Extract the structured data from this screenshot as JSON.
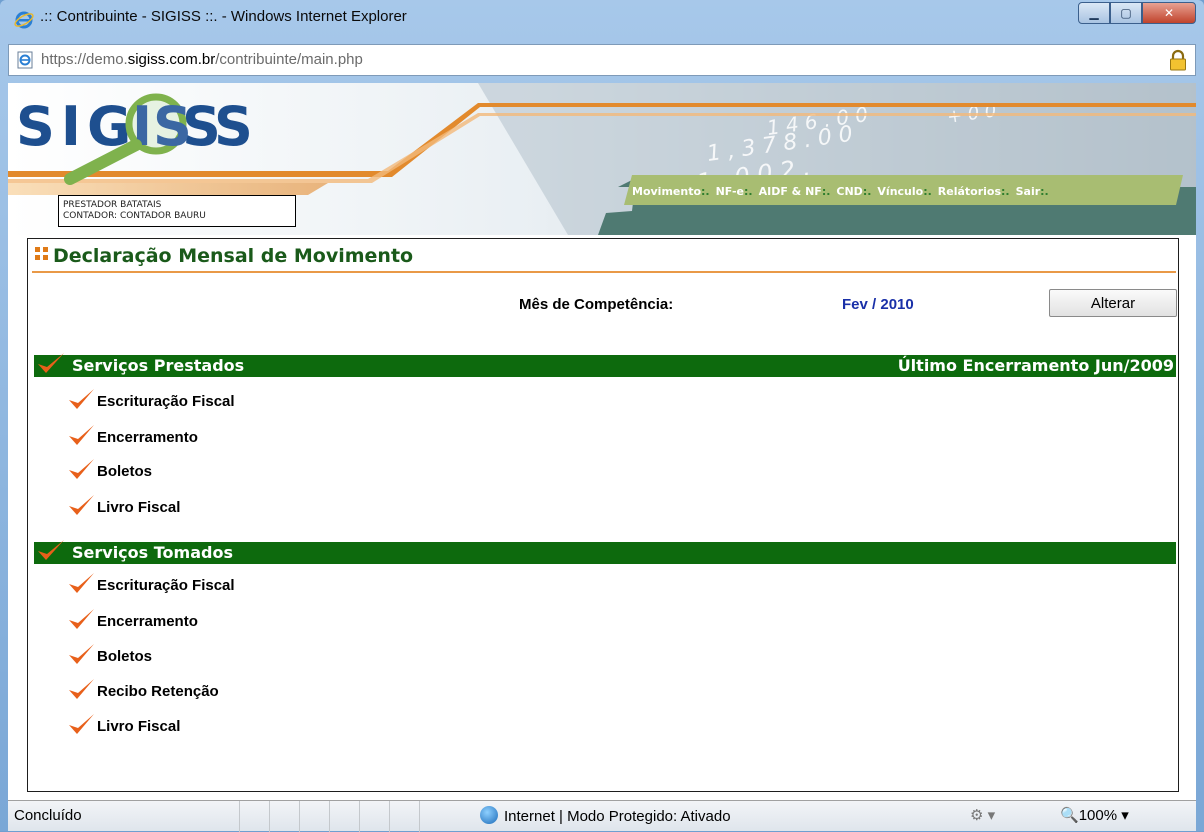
{
  "window": {
    "title": ".:: Contribuinte - SIGISS ::. - Windows Internet Explorer",
    "address_prefix": "https://demo.",
    "address_domain": "sigiss.com.br",
    "address_path": "/contribuinte/main.php"
  },
  "header": {
    "logo_text": "SIGISS",
    "user_line1": "PRESTADOR BATATAIS",
    "user_line2": "CONTADOR: CONTADOR BAURU",
    "nav": [
      {
        "label": "Movimento",
        "sep": ":."
      },
      {
        "label": "NF-e",
        "sep": ":."
      },
      {
        "label": "AIDF & NF",
        "sep": ":."
      },
      {
        "label": "CND",
        "sep": ":."
      },
      {
        "label": "Vínculo",
        "sep": ":."
      },
      {
        "label": "Relátorios",
        "sep": ":."
      },
      {
        "label": "Sair",
        "sep": ":."
      }
    ]
  },
  "main": {
    "title": "Declaração Mensal de Movimento",
    "competencia_label": "Mês de Competência:",
    "competencia_value": "Fev / 2010",
    "alterar_label": "Alterar",
    "prestados": {
      "header": "Serviços Prestados",
      "ultimo": "Último Encerramento Jun/2009",
      "items": [
        "Escrituração Fiscal",
        "Encerramento",
        "Boletos",
        "Livro Fiscal"
      ]
    },
    "tomados": {
      "header": "Serviços Tomados",
      "items": [
        "Escrituração Fiscal",
        "Encerramento",
        "Boletos",
        "Recibo Retenção",
        "Livro Fiscal"
      ]
    }
  },
  "statusbar": {
    "status": "Concluído",
    "zone": "Internet | Modo Protegido: Ativado",
    "zoom": "100%"
  },
  "colors": {
    "section_green": "#0d6a0d",
    "title_green": "#1a5a1a",
    "check_orange": "#e8601a",
    "accent_orange": "#e99947",
    "month_blue": "#1a30a8"
  }
}
